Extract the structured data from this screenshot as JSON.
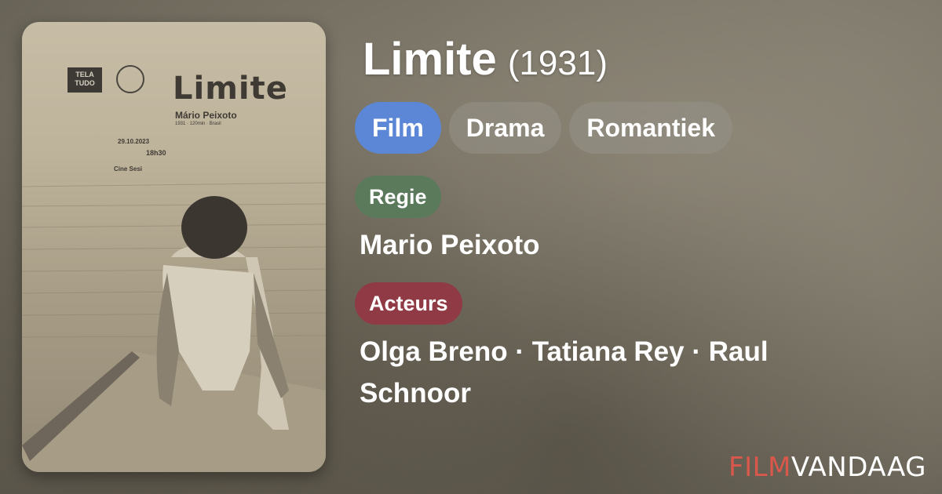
{
  "poster": {
    "logo_text": "TELA TUDO",
    "title": "Limite",
    "director": "Mário Peixoto",
    "meta": "1931 · 120min · Brasil",
    "date": "29.10.2023",
    "time": "18h30",
    "venue": "Cine Sesi"
  },
  "movie": {
    "title": "Limite",
    "year": "(1931)"
  },
  "genres": [
    "Film",
    "Drama",
    "Romantiek"
  ],
  "sections": {
    "director_label": "Regie",
    "director_value": "Mario Peixoto",
    "cast_label": "Acteurs",
    "cast_value": "Olga Breno · Tatiana Rey · Raul Schnoor"
  },
  "brand": {
    "part1": "FILM",
    "part2": "VANDAAG"
  },
  "colors": {
    "primary_chip": "#5b87d6",
    "director_tag": "#5b7a5b",
    "cast_tag": "#8f3a44",
    "brand_red": "#d9584b"
  }
}
